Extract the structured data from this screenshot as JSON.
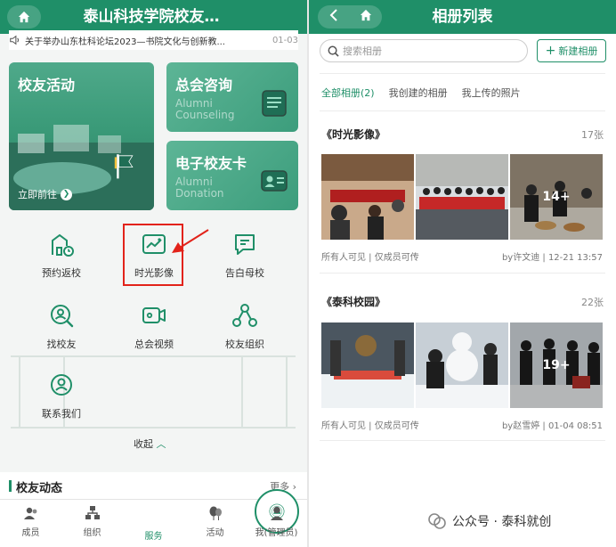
{
  "left": {
    "header": {
      "title": "泰山科技学院校友…"
    },
    "news": {
      "text": "关于举办山东杜科论坛2023—书院文化与创新教...",
      "date": "01-03"
    },
    "cards": [
      {
        "title": "校友活动",
        "cta": "立即前往"
      },
      {
        "title": "总会咨询",
        "sub": "Alumni\nCounseling"
      },
      {
        "title": "电子校友卡",
        "sub": "Alumni\nDonation"
      }
    ],
    "grid": [
      {
        "label": "预约返校",
        "icon": "building-clock-icon"
      },
      {
        "label": "时光影像",
        "icon": "image-icon"
      },
      {
        "label": "告白母校",
        "icon": "message-edit-icon"
      },
      {
        "label": "找校友",
        "icon": "search-person-icon"
      },
      {
        "label": "总会视频",
        "icon": "video-icon"
      },
      {
        "label": "校友组织",
        "icon": "organization-icon"
      },
      {
        "label": "联系我们",
        "icon": "headset-icon"
      }
    ],
    "collapse": "收起",
    "feed": {
      "title": "校友动态",
      "more": "更多"
    },
    "tabs": [
      "成员",
      "组织",
      "服务",
      "活动",
      "我(管理员)"
    ],
    "active_tab": "服务"
  },
  "right": {
    "header": {
      "title": "相册列表"
    },
    "search": {
      "placeholder": "搜索相册"
    },
    "new_button": "新建相册",
    "tabs": [
      "全部相册(2)",
      "我创建的相册",
      "我上传的照片"
    ],
    "albums": [
      {
        "title": "《时光影像》",
        "count": "17张",
        "more": "14+",
        "visibility": "所有人可见 | 仅成员可传",
        "author": "by许文迪",
        "date": "12-21 13:57"
      },
      {
        "title": "《泰科校园》",
        "count": "22张",
        "more": "19+",
        "visibility": "所有人可见 | 仅成员可传",
        "author": "by赵雪婷",
        "date": "01-04 08:51"
      }
    ]
  },
  "watermark": "公众号 · 泰科就创",
  "colors": {
    "brand": "#1f8f68",
    "highlight": "#e2231a"
  }
}
